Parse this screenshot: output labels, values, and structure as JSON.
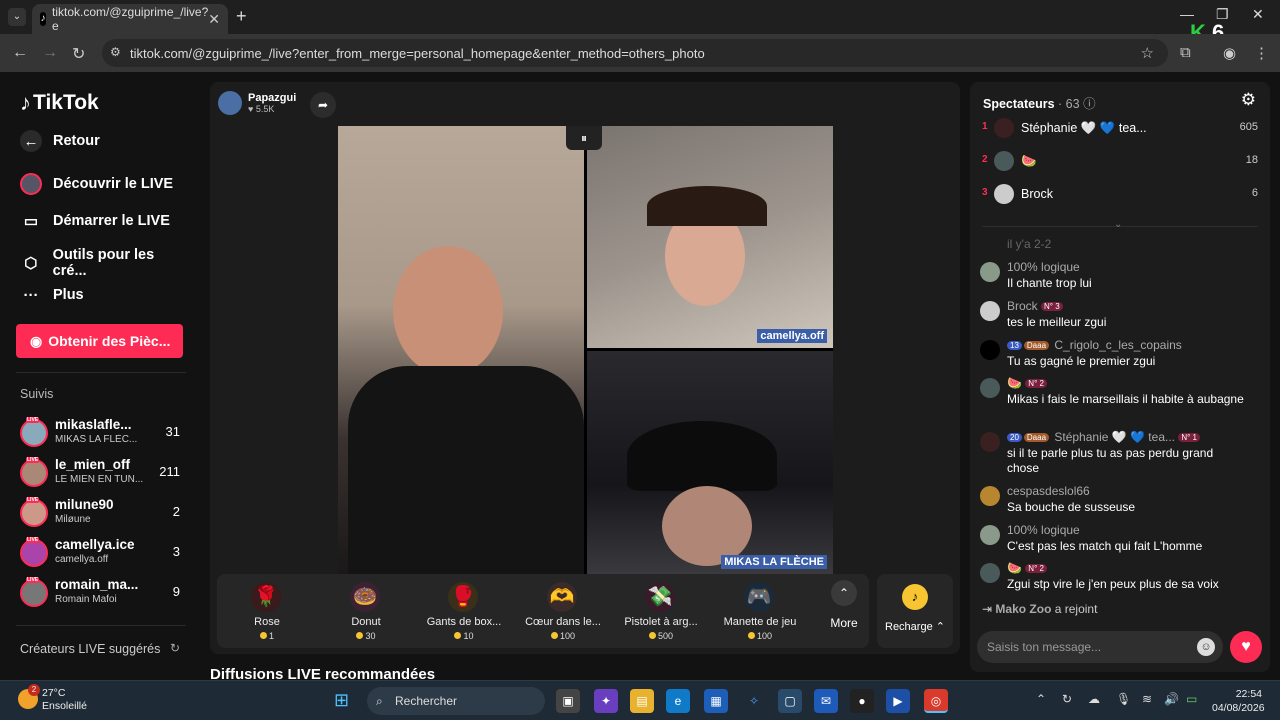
{
  "browser": {
    "tab_title": "tiktok.com/@zguiprime_/live?e",
    "url": "tiktok.com/@zguiprime_/live?enter_from_merge=personal_homepage&enter_method=others_photo",
    "overlay": "6"
  },
  "sidebar": {
    "logo": "TikTok",
    "nav": [
      {
        "label": "Retour",
        "icon": "back-arrow-icon"
      },
      {
        "label": "Découvrir le LIVE",
        "icon": "live-avatar-icon"
      },
      {
        "label": "Démarrer le LIVE",
        "icon": "camera-icon"
      },
      {
        "label": "Outils pour les cré...",
        "icon": "tools-icon"
      },
      {
        "label": "Plus",
        "icon": "more-dots-icon"
      }
    ],
    "coins_button": "Obtenir des Pièc...",
    "following_title": "Suivis",
    "following": [
      {
        "name": "mikaslafle...",
        "sub": "MIKAS LA FLÈC...",
        "count": "31"
      },
      {
        "name": "le_mien_off",
        "sub": "LE MIEN EN TUN...",
        "count": "211"
      },
      {
        "name": "milune90",
        "sub": "Miløune",
        "count": "2"
      },
      {
        "name": "camellya.ice",
        "sub": "camellya.off",
        "count": "3"
      },
      {
        "name": "romain_ma...",
        "sub": "Romain Mafoi",
        "count": "9"
      }
    ],
    "suggested_title": "Créateurs LIVE suggérés",
    "live_badge": "LIVE"
  },
  "stream": {
    "host_name": "Papazgui",
    "host_likes": "5.5K",
    "tag_top_right": "camellya.off",
    "tag_bottom_right": "MIKAS LA FLÈCHE",
    "gifts": [
      {
        "name": "Rose",
        "price": "1",
        "icon": "rose-icon",
        "glyph": "🌹",
        "bg": "#3a1a1a"
      },
      {
        "name": "Donut",
        "price": "30",
        "icon": "donut-icon",
        "glyph": "🍩",
        "bg": "#3a2233"
      },
      {
        "name": "Gants de box...",
        "price": "10",
        "icon": "boxing-gloves-icon",
        "glyph": "🥊",
        "bg": "#3a301a"
      },
      {
        "name": "Cœur dans le...",
        "price": "100",
        "icon": "heart-hands-icon",
        "glyph": "🫶",
        "bg": "#3a2a2a"
      },
      {
        "name": "Pistolet à arg...",
        "price": "500",
        "icon": "money-gun-icon",
        "glyph": "💸",
        "bg": "#3a1a2a"
      },
      {
        "name": "Manette de jeu",
        "price": "100",
        "icon": "game-controller-icon",
        "glyph": "🎮",
        "bg": "#1a2a3a"
      }
    ],
    "more_label": "More",
    "recharge_label": "Recharge"
  },
  "recommended_title": "Diffusions LIVE recommandées",
  "viewers": {
    "title": "Spectateurs",
    "count": "· 63",
    "top": [
      {
        "rank": "1",
        "name": "Stéphanie 🤍 💙 tea...",
        "score": "605"
      },
      {
        "rank": "2",
        "name": "🍉",
        "score": "18"
      },
      {
        "rank": "3",
        "name": "Brock",
        "score": "6"
      }
    ]
  },
  "chat": {
    "faded_line": "il y'a 2-2",
    "messages": [
      {
        "user": "100% logique",
        "badges": [],
        "text": "Il chante trop lui"
      },
      {
        "user": "Brock",
        "badges": [
          {
            "t": "N° 3",
            "c": "b-red"
          }
        ],
        "text": "tes le meilleur zgui"
      },
      {
        "user": "C_rigolo_c_les_copains",
        "badges": [
          {
            "t": "13",
            "c": "b-blue"
          },
          {
            "t": "Daaa",
            "c": "b-org"
          }
        ],
        "text": "Tu as gagné le premier zgui"
      },
      {
        "user": "🍉",
        "badges": [
          {
            "t": "N° 2",
            "c": "b-red"
          }
        ],
        "text": "Mikas i fais le marseillais il habite à aubagne"
      },
      {
        "user": "Stéphanie 🤍 💙 tea...",
        "badges": [
          {
            "t": "20",
            "c": "b-blue"
          },
          {
            "t": "Daaa",
            "c": "b-org"
          },
          {
            "t": "N° 1",
            "c": "b-red"
          }
        ],
        "text": "si il te parle plus tu as pas perdu grand chose"
      },
      {
        "user": "cespasdeslol66",
        "badges": [],
        "text": "Sa bouche de susseuse"
      },
      {
        "user": "100% logique",
        "badges": [],
        "text": "C'est pas les match qui fait L'homme"
      },
      {
        "user": "🍉",
        "badges": [
          {
            "t": "N° 2",
            "c": "b-red"
          }
        ],
        "text": "Zgui stp vire le j'en peux plus de sa voix"
      }
    ],
    "joined_user": "Mako Zoo",
    "joined_text": "a rejoint",
    "input_placeholder": "Saisis ton message..."
  },
  "taskbar": {
    "temp": "27°C",
    "weather": "Ensoleillé",
    "weather_badge": "2",
    "search_placeholder": "Rechercher",
    "time": "22:54",
    "date": "04/08/2026"
  }
}
